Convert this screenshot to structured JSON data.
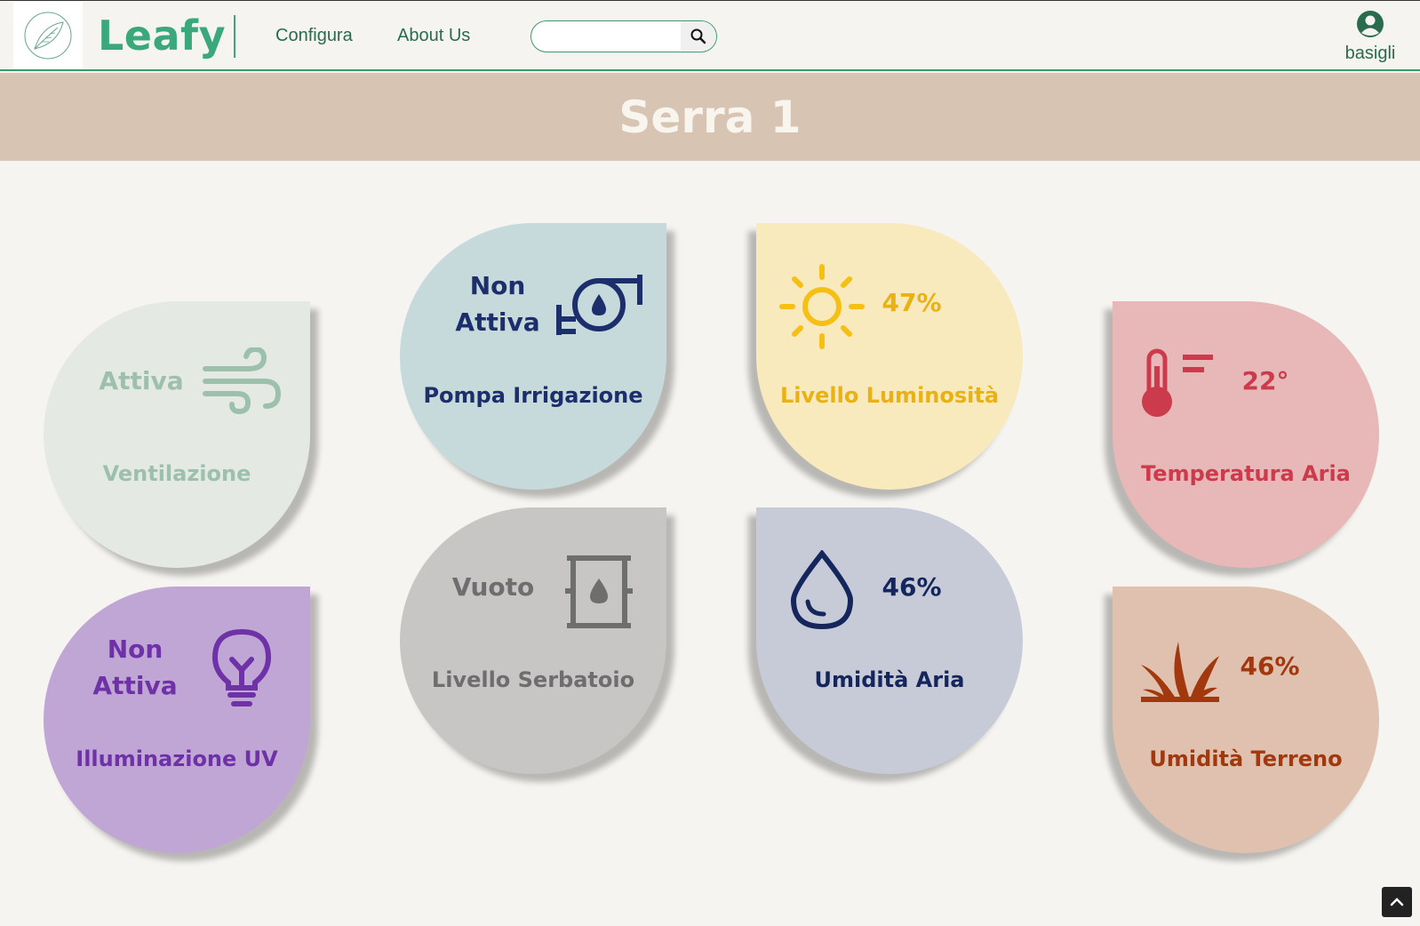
{
  "header": {
    "brand": "Leafy",
    "nav": [
      {
        "label": "Configura"
      },
      {
        "label": "About Us"
      }
    ],
    "search": {
      "placeholder": "",
      "value": ""
    },
    "user": {
      "name": "basigli"
    }
  },
  "page": {
    "title": "Serra 1"
  },
  "cards": {
    "ventilazione": {
      "value": "Attiva",
      "title": "Ventilazione",
      "icon": "wind-icon",
      "bg": "#e4e9e4",
      "color": "#9cc0ac"
    },
    "pompa": {
      "value": "Non Attiva",
      "title": "Pompa Irrigazione",
      "icon": "water-pump-icon",
      "bg": "#c7dadb",
      "color": "#1c2e6b"
    },
    "luminosita": {
      "value": "47%",
      "title": "Livello Luminosità",
      "icon": "sun-icon",
      "bg": "#f8eabd",
      "color": "#eab114"
    },
    "temperatura": {
      "value": "22°",
      "title": "Temperatura Aria",
      "icon": "thermometer-icon",
      "bg": "#e8b7b7",
      "color": "#cc3b4c"
    },
    "uv": {
      "value": "Non Attiva",
      "title": "Illuminazione UV",
      "icon": "lightbulb-icon",
      "bg": "#c0a6d4",
      "color": "#6e31a7"
    },
    "serbatoio": {
      "value": "Vuoto",
      "title": "Livello Serbatoio",
      "icon": "tank-icon",
      "bg": "#c7c6c4",
      "color": "#6e6e6e"
    },
    "umidita_aria": {
      "value": "46%",
      "title": "Umidità Aria",
      "icon": "droplet-icon",
      "bg": "#c6cbd7",
      "color": "#14265c"
    },
    "umidita_terreno": {
      "value": "46%",
      "title": "Umidità Terreno",
      "icon": "grass-icon",
      "bg": "#e0c1af",
      "color": "#a2380e"
    }
  }
}
